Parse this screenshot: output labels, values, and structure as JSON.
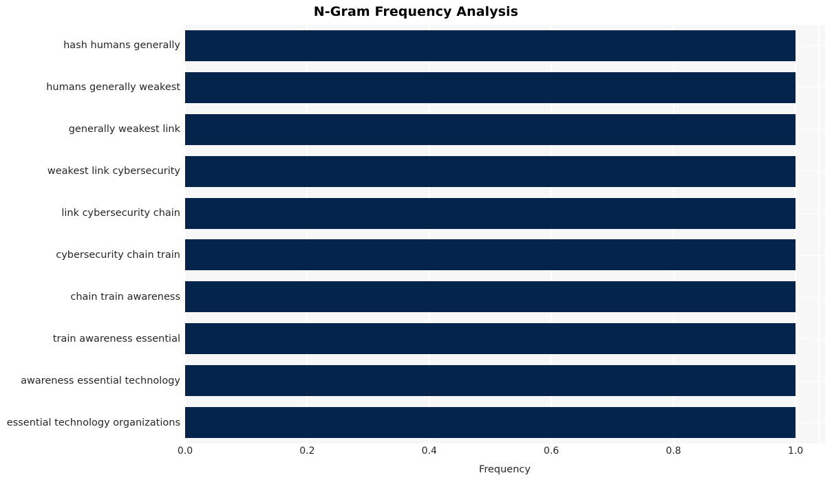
{
  "chart_data": {
    "type": "bar",
    "orientation": "horizontal",
    "title": "N-Gram Frequency Analysis",
    "xlabel": "Frequency",
    "ylabel": "",
    "categories": [
      "hash humans generally",
      "humans generally weakest",
      "generally weakest link",
      "weakest link cybersecurity",
      "link cybersecurity chain",
      "cybersecurity chain train",
      "chain train awareness",
      "train awareness essential",
      "awareness essential technology",
      "essential technology organizations"
    ],
    "values": [
      1.0,
      1.0,
      1.0,
      1.0,
      1.0,
      1.0,
      1.0,
      1.0,
      1.0,
      1.0
    ],
    "xlim": [
      0.0,
      1.05
    ],
    "xticks": [
      0.0,
      0.2,
      0.4,
      0.6,
      0.8,
      1.0
    ],
    "xtick_labels": [
      "0.0",
      "0.2",
      "0.4",
      "0.6",
      "0.8",
      "1.0"
    ],
    "grid": true,
    "legend": false,
    "bar_color": "#04244b",
    "plot_background": "#f7f7f7",
    "figure_background": "#ffffff",
    "gridline_color": "#ffffff",
    "text_color": "#262626"
  }
}
